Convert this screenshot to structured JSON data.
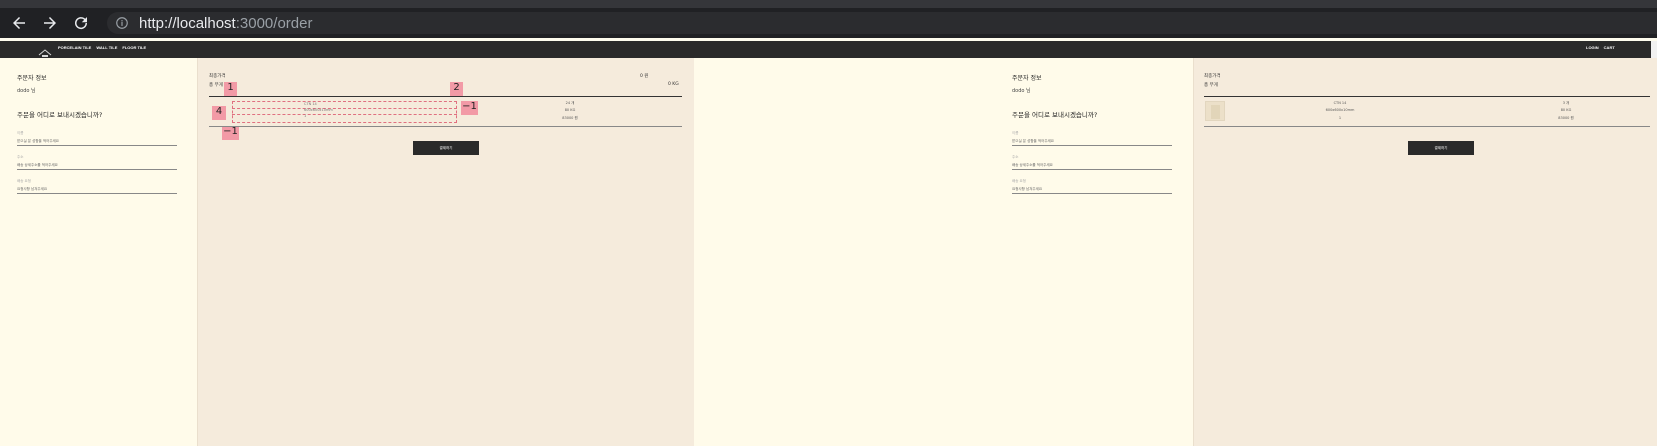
{
  "browser": {
    "url_host": "http://localhost",
    "url_rest": ":3000/order"
  },
  "nav": {
    "links": [
      "PORCELAIN TILE",
      "WALL TILE",
      "FLOOR TILE"
    ],
    "right": [
      "LOGIN",
      "CART"
    ]
  },
  "left_pane": {
    "orderer_title": "주문자 정보",
    "orderer_name": "dodo 님",
    "shipping_question": "주문을 어디로 보내시겠습니까?",
    "fields": [
      {
        "label": "이름",
        "placeholder": "받으실 분 성함을 적어주세요"
      },
      {
        "label": "주소",
        "placeholder": "배송 상세주소를 적어주세요"
      },
      {
        "label": "배송 요청",
        "placeholder": "요청사항 남겨주세요"
      }
    ],
    "summary": {
      "total_price_label": "최종가격",
      "total_price_value": "0 원",
      "total_weight_label": "총 무게",
      "total_weight_value": "0 KG"
    },
    "item": {
      "name": "CTN 14",
      "size": "600x600x10mm",
      "qty": "1",
      "count": "24 개",
      "weight": "80 KG",
      "price": "83000 원"
    },
    "button_label": "결제하기",
    "overlay_tags": [
      "1",
      "2",
      "4",
      "−1",
      "−1"
    ]
  },
  "right_pane": {
    "orderer_title": "주문자 정보",
    "orderer_name": "dodo 님",
    "shipping_question": "주문을 어디로 보내시겠습니까?",
    "fields": [
      {
        "label": "이름",
        "placeholder": "받으실 분 성함을 적어주세요"
      },
      {
        "label": "주소",
        "placeholder": "배송 상세주소를 적어주세요"
      },
      {
        "label": "배송 요청",
        "placeholder": "요청사항 남겨주세요"
      }
    ],
    "summary": {
      "total_price_label": "최종가격",
      "total_weight_label": "총 무게"
    },
    "item": {
      "name": "CTN 14",
      "size": "600x600x10mm",
      "qty": "1",
      "count": "3 개",
      "weight": "80 KG",
      "price": "83000 원"
    },
    "button_label": "결제하기"
  }
}
